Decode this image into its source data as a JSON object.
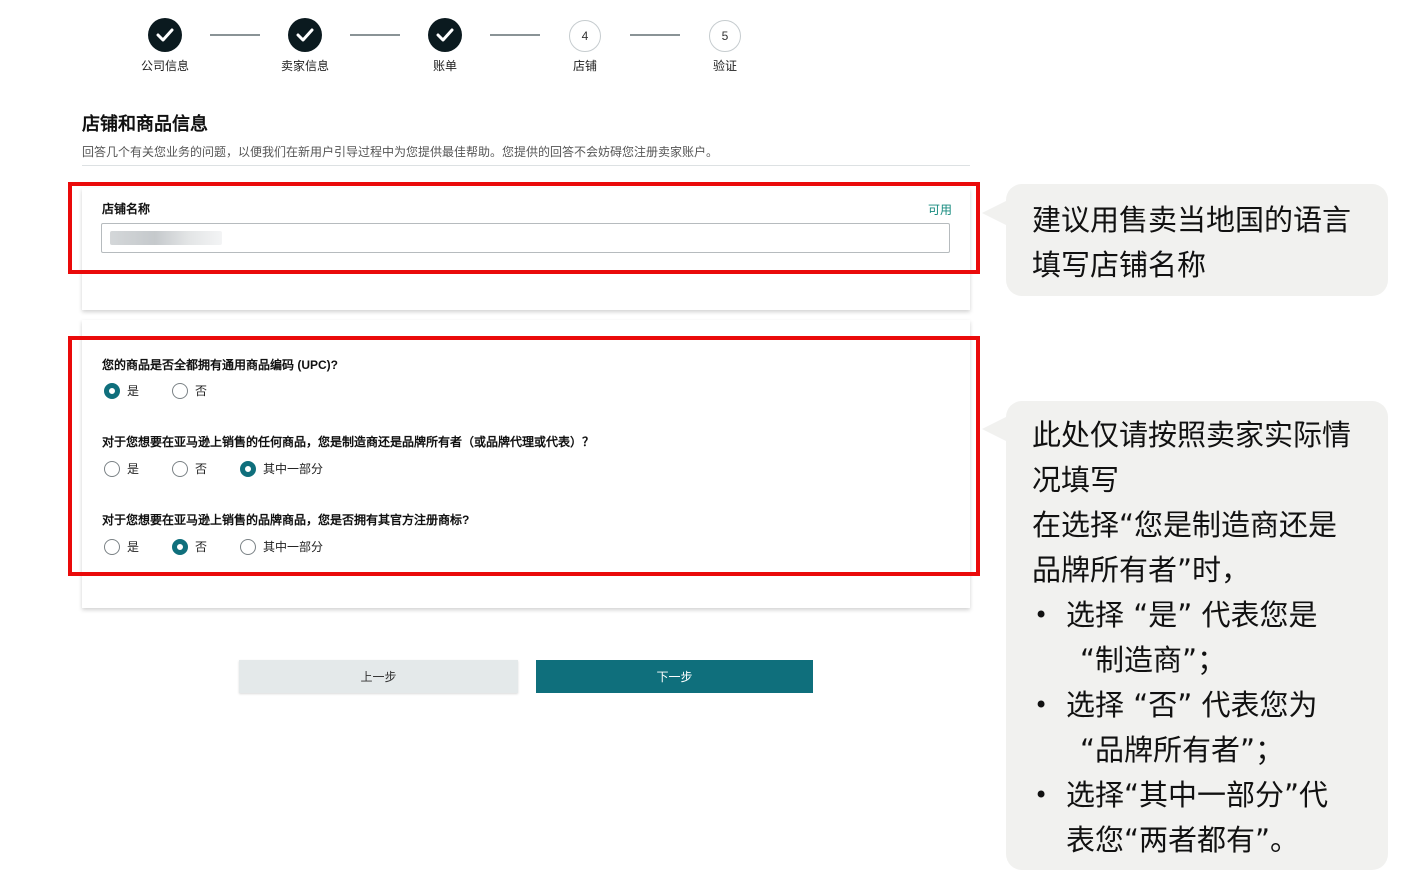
{
  "stepper": {
    "steps": [
      {
        "label": "公司信息",
        "state": "done"
      },
      {
        "label": "卖家信息",
        "state": "done"
      },
      {
        "label": "账单",
        "state": "done"
      },
      {
        "label": "店铺",
        "number": "4",
        "state": "todo"
      },
      {
        "label": "验证",
        "number": "5",
        "state": "todo"
      }
    ]
  },
  "form": {
    "title": "店铺和商品信息",
    "description": "回答几个有关您业务的问题，以便我们在新用户引导过程中为您提供最佳帮助。您提供的回答不会妨碍您注册卖家账户。",
    "store_name": {
      "label": "店铺名称",
      "status": "可用",
      "value": ""
    },
    "questions": [
      {
        "text": "您的商品是否全都拥有通用商品编码 (UPC)?",
        "options": [
          "是",
          "否"
        ],
        "selected": "是"
      },
      {
        "text": "对于您想要在亚马逊上销售的任何商品，您是制造商还是品牌所有者（或品牌代理或代表）？",
        "options": [
          "是",
          "否",
          "其中一部分"
        ],
        "selected": "其中一部分"
      },
      {
        "text": "对于您想要在亚马逊上销售的品牌商品，您是否拥有其官方注册商标?",
        "options": [
          "是",
          "否",
          "其中一部分"
        ],
        "selected": "否"
      }
    ],
    "buttons": {
      "prev": "上一步",
      "next": "下一步"
    }
  },
  "callouts": {
    "first": {
      "lines": [
        "建议用售卖当地国的语言",
        "填写店铺名称"
      ]
    },
    "second": {
      "lines": [
        "此处仅请按照卖家实际情",
        "况填写",
        "在选择“您是制造商还是",
        "品牌所有者”时，"
      ],
      "bullets": [
        [
          "选择 “是” 代表您是",
          "“制造商”；"
        ],
        [
          "选择 “否” 代表您为",
          "“品牌所有者”；"
        ],
        [
          "选择“其中一部分”代",
          "表您“两者都有”。"
        ]
      ]
    }
  },
  "colors": {
    "accent": "#0f6f7c",
    "available": "#158a7e",
    "highlight_frame": "#ea0a0a",
    "callout_bg": "#f1f1ef"
  }
}
